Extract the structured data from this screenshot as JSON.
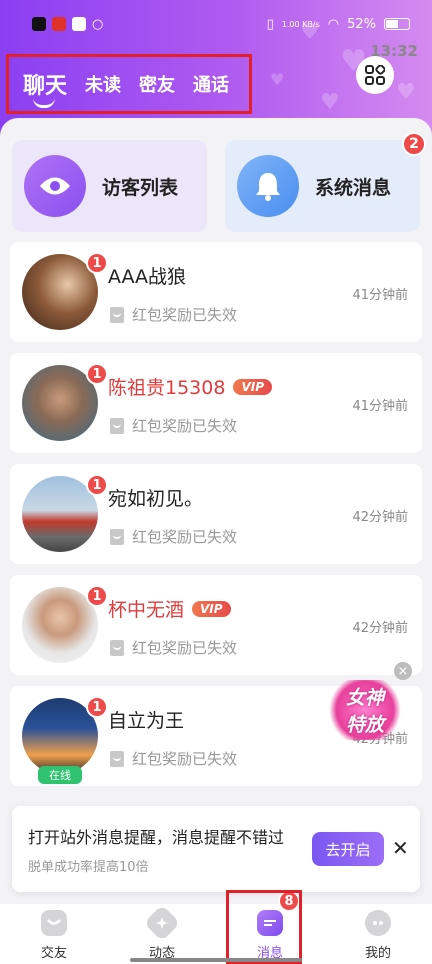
{
  "status_bar": {
    "time": "13:32",
    "net_speed": "1.00 KB/s",
    "battery": "52%",
    "icon_colors": [
      "#111111",
      "#e0302a",
      "#ffffff"
    ]
  },
  "top_tabs": [
    {
      "label": "聊天",
      "active": true
    },
    {
      "label": "未读",
      "active": false
    },
    {
      "label": "密友",
      "active": false
    },
    {
      "label": "通话",
      "active": false
    }
  ],
  "quick_actions": {
    "visitor": {
      "label": "访客列表"
    },
    "system": {
      "label": "系统消息",
      "badge": "2"
    }
  },
  "conversations": [
    {
      "name": "AAA战狼",
      "vip": false,
      "badge": "1",
      "message": "红包奖励已失效",
      "time": "41分钟前",
      "online": false
    },
    {
      "name": "陈祖贵15308",
      "vip": true,
      "vip_label": "VIP",
      "badge": "1",
      "message": "红包奖励已失效",
      "time": "41分钟前",
      "online": false
    },
    {
      "name": "宛如初见。",
      "vip": false,
      "badge": "1",
      "message": "红包奖励已失效",
      "time": "42分钟前",
      "online": false
    },
    {
      "name": "杯中无酒",
      "vip": true,
      "vip_label": "VIP",
      "badge": "1",
      "message": "红包奖励已失效",
      "time": "42分钟前",
      "online": false
    },
    {
      "name": "自立为王",
      "vip": false,
      "badge": "1",
      "message": "红包奖励已失效",
      "time": "42分钟前",
      "online": true,
      "online_label": "在线"
    }
  ],
  "promo": {
    "line1": "女神",
    "line2": "特放",
    "close": "×"
  },
  "notice": {
    "title": "打开站外消息提醒，消息提醒不错过",
    "subtitle": "脱单成功率提高10倍",
    "button": "去开启",
    "close": "✕"
  },
  "bottom_nav": [
    {
      "label": "交友",
      "active": false
    },
    {
      "label": "动态",
      "active": false
    },
    {
      "label": "消息",
      "active": true,
      "badge": "8"
    },
    {
      "label": "我的",
      "active": false
    }
  ],
  "colors": {
    "accent": "#8a4ff0",
    "badge": "#ef4a4a",
    "vip_name": "#e03c3c",
    "online": "#2fc36f",
    "highlight_box": "#e2202a"
  }
}
